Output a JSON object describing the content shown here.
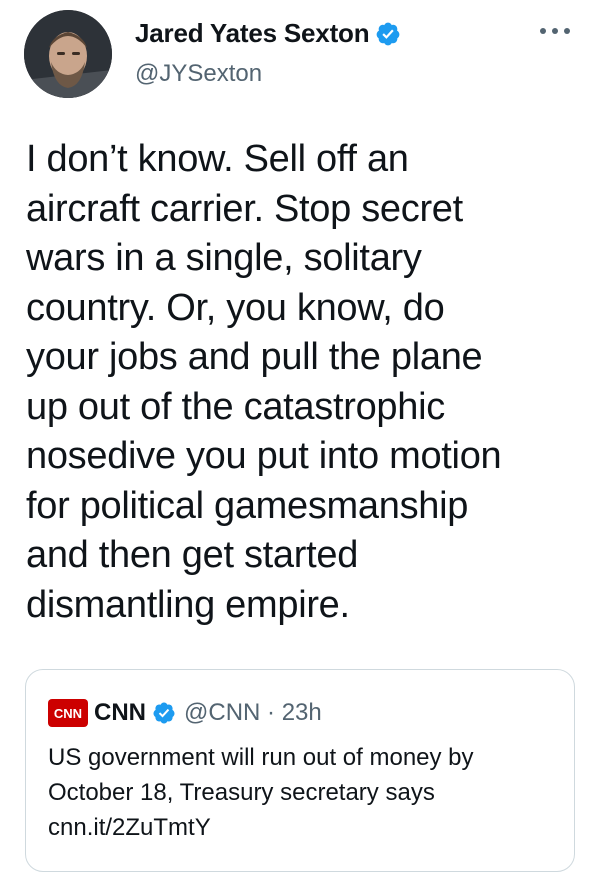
{
  "author": {
    "name": "Jared Yates Sexton",
    "handle": "@JYSexton",
    "verified": true
  },
  "tweet": {
    "text": "I don’t know. Sell off an\naircraft carrier. Stop secret\nwars in a single, solitary\ncountry. Or, you know, do\nyour jobs and pull the plane\nup out of the catastrophic\nnosedive you put into motion\nfor political gamesmanship\nand then get started\ndismantling empire."
  },
  "quoted_tweet": {
    "logo_text": "CNN",
    "name": "CNN",
    "handle_time": "@CNN · 23h",
    "text": "US government will run out of money by\nOctober 18, Treasury secretary says\ncnn.it/2ZuTmtY"
  },
  "colors": {
    "verified": "#1d9bf0",
    "cnn_red": "#cc0000",
    "secondary_text": "#536471",
    "border": "#cfd9de"
  },
  "icons": {
    "verified": "verified-badge-icon",
    "more": "more-options-icon"
  }
}
